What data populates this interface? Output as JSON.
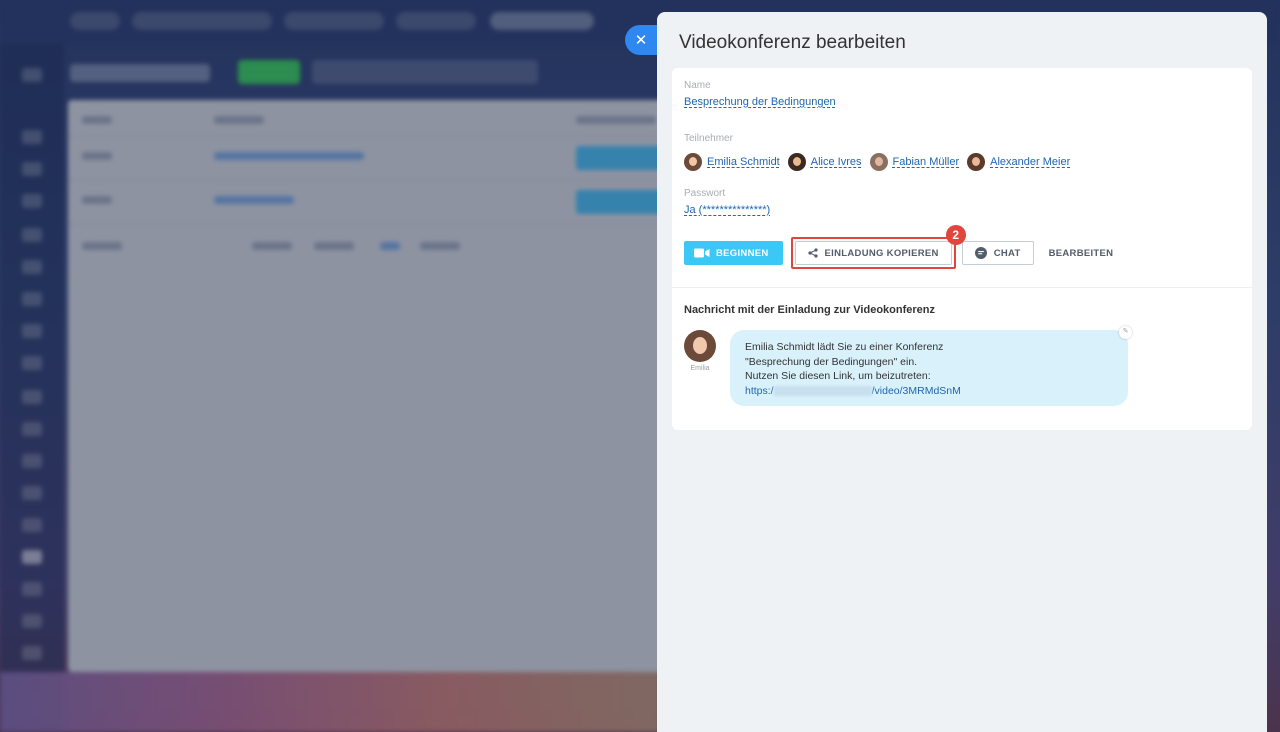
{
  "panel": {
    "title": "Videokonferenz bearbeiten",
    "close_icon": "close-icon"
  },
  "conference": {
    "name_label": "Name",
    "name_value": "Besprechung der Bedingungen",
    "participants_label": "Teilnehmer",
    "participants": [
      {
        "name": "Emilia Schmidt",
        "hair": "#6b4a3a"
      },
      {
        "name": "Alice Ivres",
        "hair": "#3a2a20"
      },
      {
        "name": "Fabian Müller",
        "hair": "#8a7060"
      },
      {
        "name": "Alexander Meier",
        "hair": "#5a3a2a"
      }
    ],
    "password_label": "Passwort",
    "password_value": "Ja (***************)"
  },
  "actions": {
    "start_label": "BEGINNEN",
    "start_icon": "video-camera-icon",
    "copy_invite_label": "EINLADUNG KOPIEREN",
    "copy_invite_icon": "share-icon",
    "step_badge": "2",
    "chat_label": "CHAT",
    "chat_icon": "chat-icon",
    "edit_label": "BEARBEITEN"
  },
  "invitation": {
    "heading": "Nachricht mit der Einladung zur Videokonferenz",
    "sender_name": "Emilia",
    "line1": "Emilia Schmidt lädt Sie zu einer Konferenz",
    "line2": "\"Besprechung der Bedingungen\" ein.",
    "line3": "Nutzen Sie diesen Link, um beizutreten:",
    "link_prefix": "https:/",
    "link_suffix": "/video/3MRMdSnM"
  },
  "colors": {
    "accent_blue": "#2f87f0",
    "start_button": "#3bc8f5",
    "highlight_red": "#e0453e",
    "bubble_bg": "#d9f1fb"
  }
}
